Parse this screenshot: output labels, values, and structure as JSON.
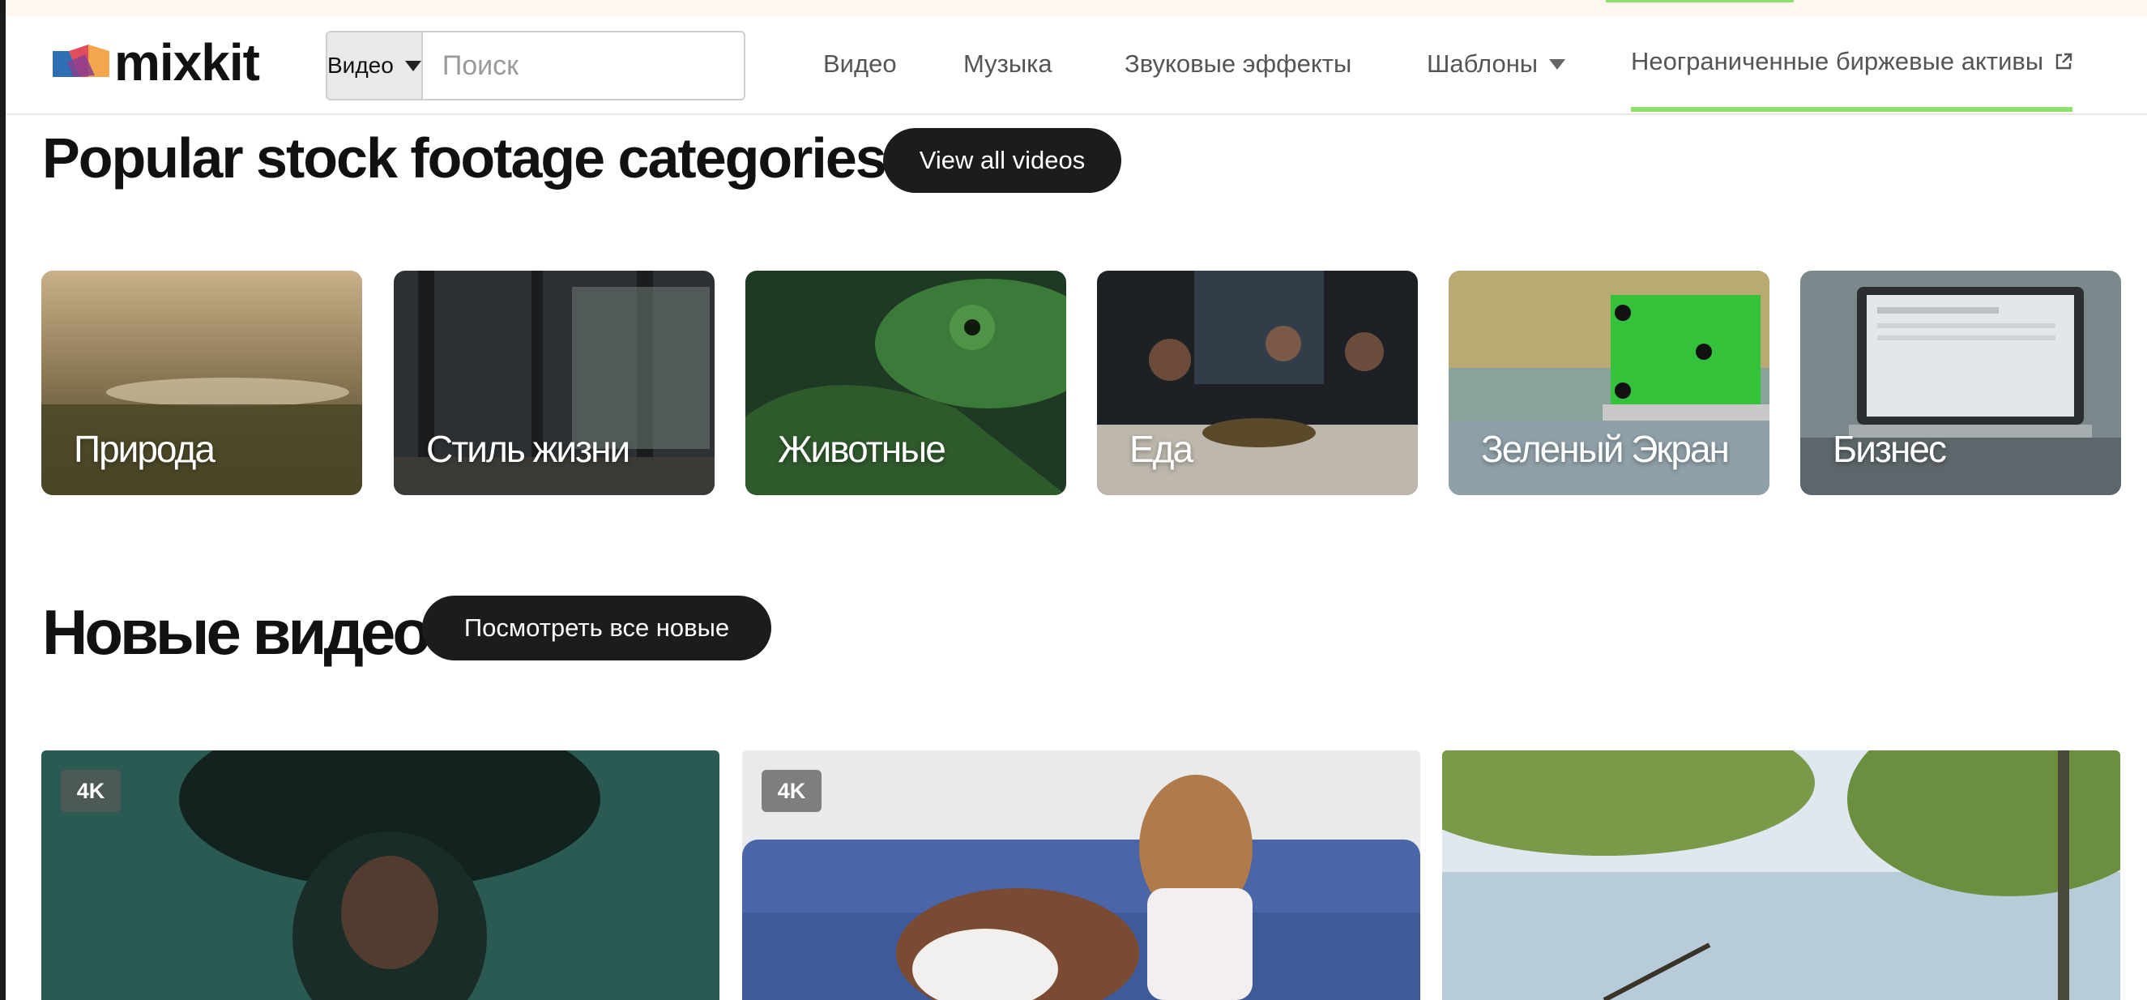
{
  "header": {
    "logo_text": "mixkit",
    "search": {
      "type_label": "Видео",
      "placeholder": "Поиск",
      "value": ""
    },
    "nav": [
      {
        "label": "Видео"
      },
      {
        "label": "Музыка"
      },
      {
        "label": "Звуковые эффекты"
      },
      {
        "label": "Шаблоны"
      },
      {
        "label": "Неограниченные биржевые активы"
      }
    ],
    "accent_color": "#8ee06b"
  },
  "popular": {
    "title": "Popular stock footage categories",
    "view_all_label": "View all videos",
    "categories": [
      {
        "label": "Природа"
      },
      {
        "label": "Стиль жизни"
      },
      {
        "label": "Животные"
      },
      {
        "label": "Еда"
      },
      {
        "label": "Зеленый Экран"
      },
      {
        "label": "Бизнес"
      }
    ]
  },
  "new_videos": {
    "title": "Новые видео",
    "view_all_label": "Посмотреть все новые",
    "videos": [
      {
        "badge": "4K"
      },
      {
        "badge": "4K"
      },
      {
        "badge": ""
      }
    ]
  },
  "icons": {
    "search": "search-icon",
    "dropdown": "caret-down-icon",
    "external": "external-link-icon"
  }
}
